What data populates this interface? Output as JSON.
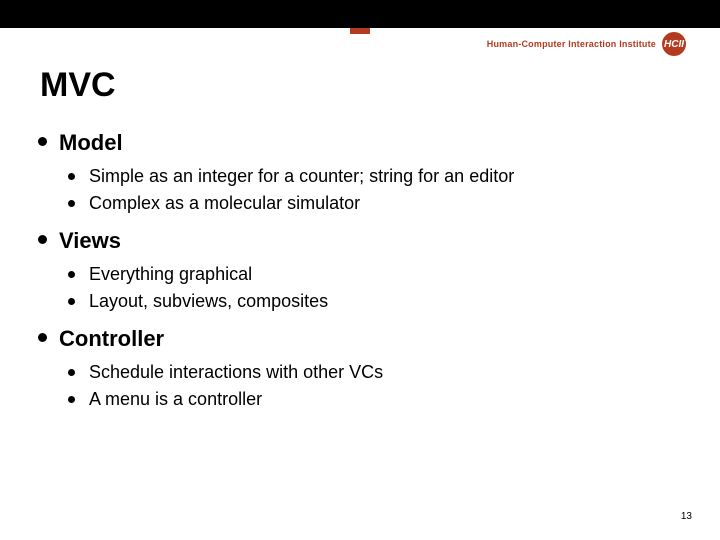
{
  "header": {
    "institute": "Human-Computer Interaction Institute",
    "logo_abbr": "HCII"
  },
  "title": "MVC",
  "sections": [
    {
      "heading": "Model",
      "items": [
        "Simple as an integer for a counter; string for an editor",
        "Complex as a molecular simulator"
      ]
    },
    {
      "heading": "Views",
      "items": [
        "Everything graphical",
        "Layout, subviews, composites"
      ]
    },
    {
      "heading": "Controller",
      "items": [
        "Schedule interactions with other VCs",
        "A menu is a controller"
      ]
    }
  ],
  "page_number": "13"
}
